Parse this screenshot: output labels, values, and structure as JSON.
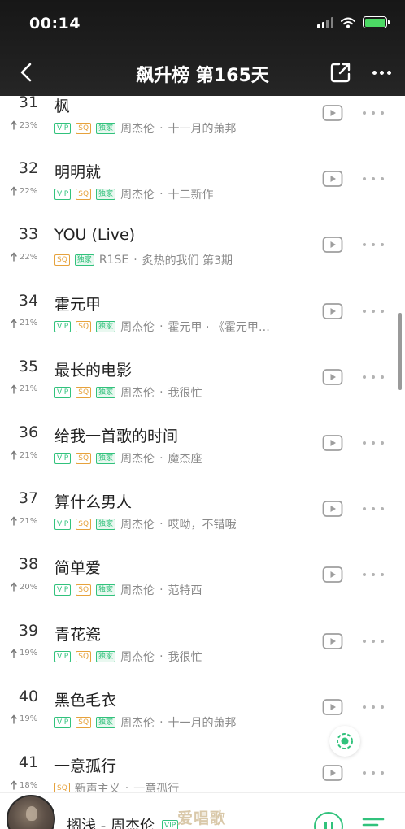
{
  "status_bar": {
    "time": "00:14",
    "icons": [
      "signal-icon",
      "wifi-icon",
      "battery-charging-icon"
    ]
  },
  "nav": {
    "back_icon": "chevron-left-icon",
    "title": "飙升榜 第165天",
    "share_icon": "share-icon",
    "more_icon": "more-icon"
  },
  "colors": {
    "accent": "#31c27c",
    "sq": "#e6a23c",
    "header_bg": "#1c1c1c"
  },
  "songs": [
    {
      "rank": "31",
      "title": "枫",
      "trend": "23%",
      "tags": [
        "VIP",
        "SQ",
        "独家"
      ],
      "artist": "周杰伦",
      "album": "十一月的萧邦"
    },
    {
      "rank": "32",
      "title": "明明就",
      "trend": "22%",
      "tags": [
        "VIP",
        "SQ",
        "独家"
      ],
      "artist": "周杰伦",
      "album": "十二新作"
    },
    {
      "rank": "33",
      "title": "YOU (Live)",
      "trend": "22%",
      "tags": [
        "SQ",
        "独家"
      ],
      "artist": "R1SE",
      "album": "炙热的我们 第3期"
    },
    {
      "rank": "34",
      "title": "霍元甲",
      "trend": "21%",
      "tags": [
        "VIP",
        "SQ",
        "独家"
      ],
      "artist": "周杰伦",
      "album": "霍元甲 · 《霍元甲…"
    },
    {
      "rank": "35",
      "title": "最长的电影",
      "trend": "21%",
      "tags": [
        "VIP",
        "SQ",
        "独家"
      ],
      "artist": "周杰伦",
      "album": "我很忙"
    },
    {
      "rank": "36",
      "title": "给我一首歌的时间",
      "trend": "21%",
      "tags": [
        "VIP",
        "SQ",
        "独家"
      ],
      "artist": "周杰伦",
      "album": "魔杰座"
    },
    {
      "rank": "37",
      "title": "算什么男人",
      "trend": "21%",
      "tags": [
        "VIP",
        "SQ",
        "独家"
      ],
      "artist": "周杰伦",
      "album": "哎呦，不错哦"
    },
    {
      "rank": "38",
      "title": "简单爱",
      "trend": "20%",
      "tags": [
        "VIP",
        "SQ",
        "独家"
      ],
      "artist": "周杰伦",
      "album": "范特西"
    },
    {
      "rank": "39",
      "title": "青花瓷",
      "trend": "19%",
      "tags": [
        "VIP",
        "SQ",
        "独家"
      ],
      "artist": "周杰伦",
      "album": "我很忙"
    },
    {
      "rank": "40",
      "title": "黑色毛衣",
      "trend": "19%",
      "tags": [
        "VIP",
        "SQ",
        "独家"
      ],
      "artist": "周杰伦",
      "album": "十一月的萧邦"
    },
    {
      "rank": "41",
      "title": "一意孤行",
      "trend": "18%",
      "tags": [
        "SQ"
      ],
      "artist": "新声主义",
      "album": "一意孤行"
    }
  ],
  "player": {
    "song": "搁浅 - 周杰伦",
    "vip_tag": "VIP",
    "watermark": "爱唱歌",
    "pause_icon": "pause-icon",
    "playlist_icon": "playlist-icon"
  }
}
